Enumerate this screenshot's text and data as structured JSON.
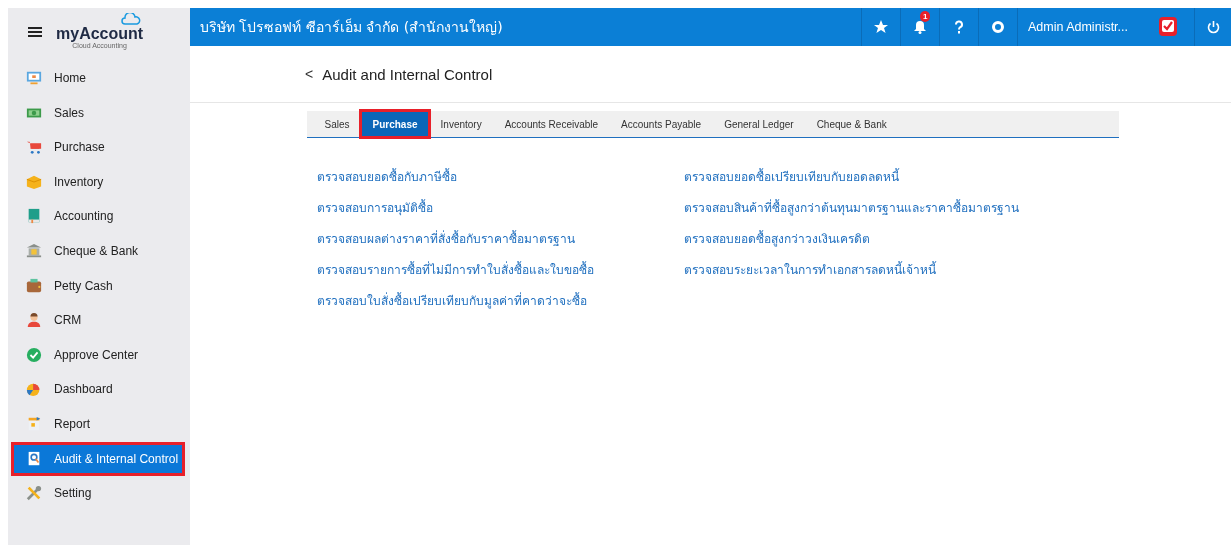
{
  "topbar": {
    "company": "บริษัท โปรซอฟท์ ซีอาร์เอ็ม จำกัด (สำนักงานใหญ่)",
    "notification_count": "1",
    "user": "Admin Administr..."
  },
  "sidebar": {
    "logo": "myAccount",
    "logo_subtitle": "Cloud Accounting",
    "items": [
      {
        "label": "Home",
        "selected": false
      },
      {
        "label": "Sales",
        "selected": false
      },
      {
        "label": "Purchase",
        "selected": false
      },
      {
        "label": "Inventory",
        "selected": false
      },
      {
        "label": "Accounting",
        "selected": false
      },
      {
        "label": "Cheque & Bank",
        "selected": false
      },
      {
        "label": "Petty Cash",
        "selected": false
      },
      {
        "label": "CRM",
        "selected": false
      },
      {
        "label": "Approve Center",
        "selected": false
      },
      {
        "label": "Dashboard",
        "selected": false
      },
      {
        "label": "Report",
        "selected": false
      },
      {
        "label": "Audit & Internal Control",
        "selected": true
      },
      {
        "label": "Setting",
        "selected": false
      }
    ]
  },
  "page": {
    "back": "<",
    "title": "Audit and Internal Control"
  },
  "tabs": [
    {
      "label": "Sales",
      "selected": false
    },
    {
      "label": "Purchase",
      "selected": true
    },
    {
      "label": "Inventory",
      "selected": false
    },
    {
      "label": "Accounts Receivable",
      "selected": false
    },
    {
      "label": "Accounts Payable",
      "selected": false
    },
    {
      "label": "General Ledger",
      "selected": false
    },
    {
      "label": "Cheque & Bank",
      "selected": false
    }
  ],
  "links": {
    "column_1": [
      "ตรวจสอบยอดซื้อกับภาษีซื้อ",
      "ตรวจสอบการอนุมัติซื้อ",
      "ตรวจสอบผลต่างราคาที่สั่งซื้อกับราคาซื้อมาตรฐาน",
      "ตรวจสอบรายการซื้อที่ไม่มีการทำใบสั่งซื้อและใบขอซื้อ",
      "ตรวจสอบใบสั่งซื้อเปรียบเทียบกับมูลค่าที่คาดว่าจะซื้อ"
    ],
    "column_2": [
      "ตรวจสอบยอดซื้อเปรียบเทียบกับยอดลดหนี้",
      "ตรวจสอบสินค้าที่ซื้อสูงกว่าต้นทุนมาตรฐานและราคาซื้อมาตรฐาน",
      "ตรวจสอบยอดซื้อสูงกว่าวงเงินเครดิต",
      "ตรวจสอบระยะเวลาในการทำเอกสารลดหนี้เจ้าหนี้"
    ]
  }
}
